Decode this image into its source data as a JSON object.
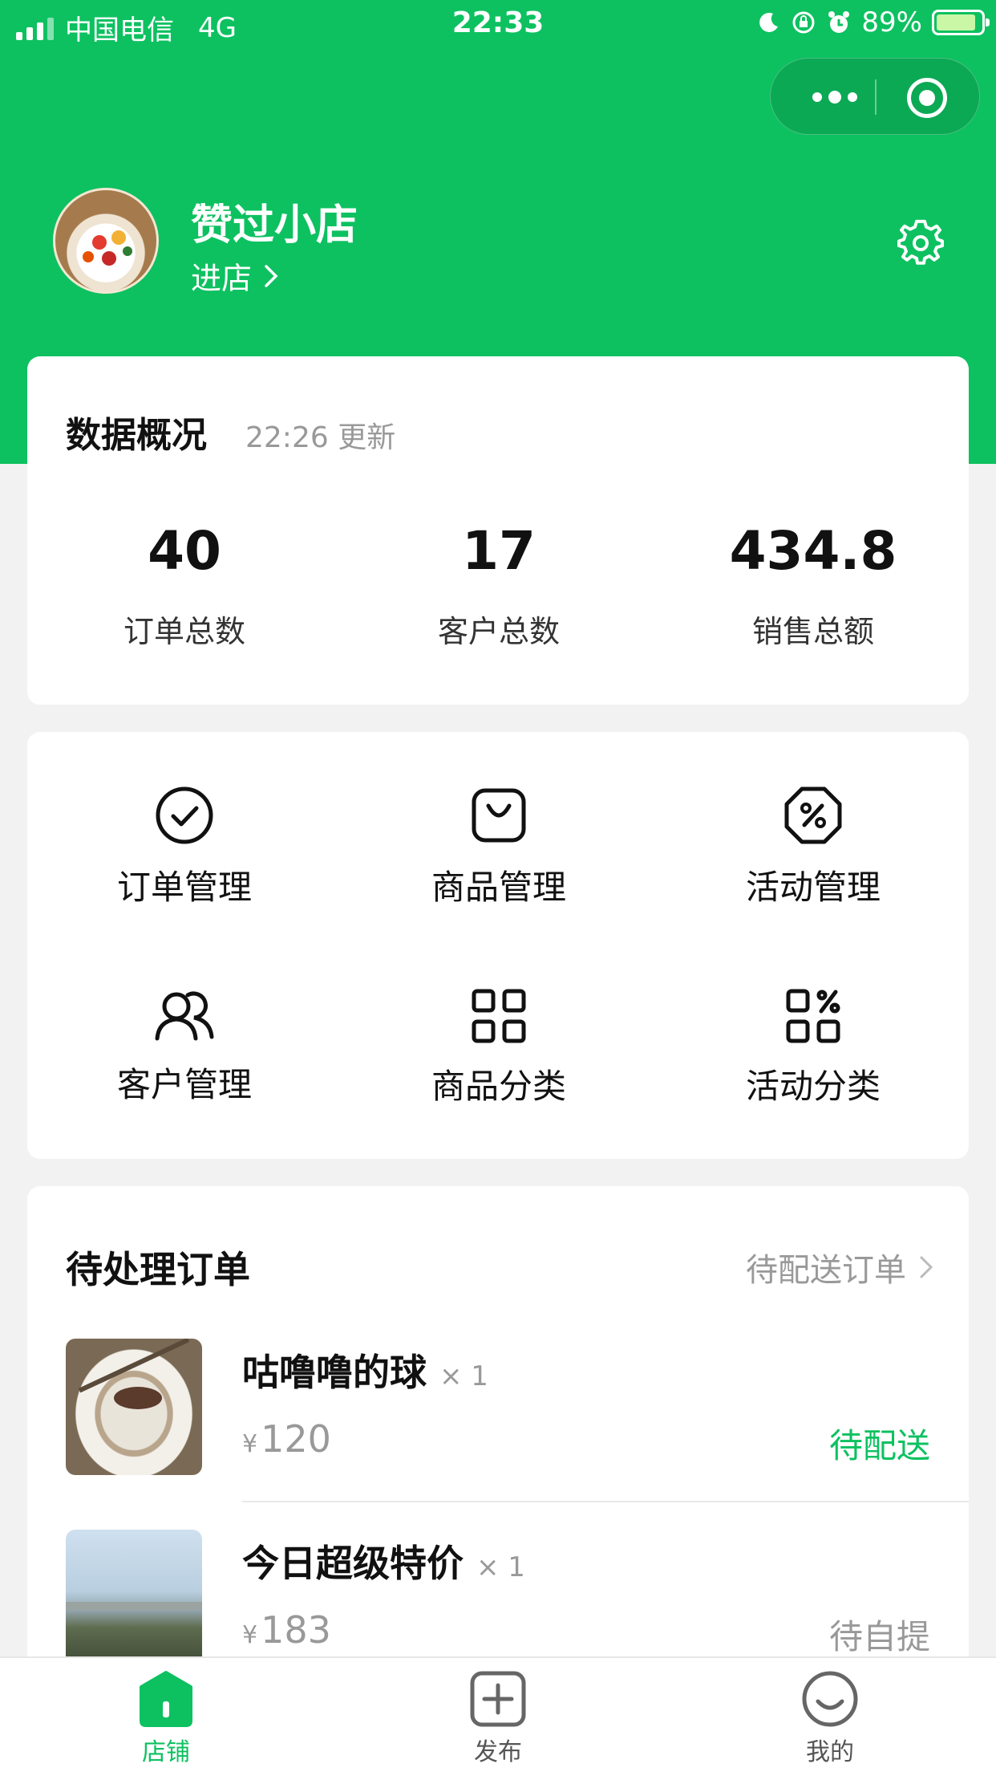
{
  "status_bar": {
    "carrier": "中国电信",
    "network": "4G",
    "time": "22:33",
    "battery": "89%",
    "battery_level": 0.89
  },
  "shop": {
    "name": "赞过小店",
    "enter_label": "进店"
  },
  "stats": {
    "title": "数据概况",
    "updated": "22:26 更新",
    "items": [
      {
        "value": "40",
        "label": "订单总数"
      },
      {
        "value": "17",
        "label": "客户总数"
      },
      {
        "value": "434.8",
        "label": "销售总额"
      }
    ]
  },
  "menu": {
    "items": [
      {
        "label": "订单管理",
        "icon": "check-circle-icon"
      },
      {
        "label": "商品管理",
        "icon": "shopping-bag-icon"
      },
      {
        "label": "活动管理",
        "icon": "discount-icon"
      },
      {
        "label": "客户管理",
        "icon": "users-icon"
      },
      {
        "label": "商品分类",
        "icon": "grid-icon"
      },
      {
        "label": "活动分类",
        "icon": "grid-percent-icon"
      }
    ]
  },
  "orders": {
    "title": "待处理订单",
    "link_label": "待配送订单",
    "items": [
      {
        "name": "咕噜噜的球",
        "qty": "× 1",
        "currency": "¥",
        "price": "120",
        "status": "待配送",
        "status_color": "#0dc160"
      },
      {
        "name": "今日超级特价",
        "qty": "× 1",
        "currency": "¥",
        "price": "183",
        "status": "待自提",
        "status_color": "#999999"
      }
    ]
  },
  "tabbar": {
    "items": [
      {
        "label": "店铺",
        "icon": "shop-icon",
        "active": true
      },
      {
        "label": "发布",
        "icon": "add-square-icon",
        "active": false
      },
      {
        "label": "我的",
        "icon": "smile-icon",
        "active": false
      }
    ]
  },
  "colors": {
    "brand_green": "#0dc160",
    "muted": "#999999"
  }
}
